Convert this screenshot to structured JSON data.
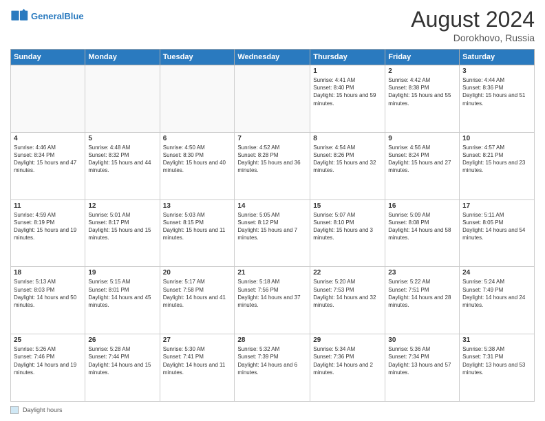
{
  "header": {
    "logo_line1": "General",
    "logo_line2": "Blue",
    "month_year": "August 2024",
    "location": "Dorokhovo, Russia"
  },
  "days_of_week": [
    "Sunday",
    "Monday",
    "Tuesday",
    "Wednesday",
    "Thursday",
    "Friday",
    "Saturday"
  ],
  "weeks": [
    [
      {
        "day": "",
        "sunrise": "",
        "sunset": "",
        "daylight": "",
        "empty": true
      },
      {
        "day": "",
        "sunrise": "",
        "sunset": "",
        "daylight": "",
        "empty": true
      },
      {
        "day": "",
        "sunrise": "",
        "sunset": "",
        "daylight": "",
        "empty": true
      },
      {
        "day": "",
        "sunrise": "",
        "sunset": "",
        "daylight": "",
        "empty": true
      },
      {
        "day": "1",
        "sunrise": "Sunrise: 4:41 AM",
        "sunset": "Sunset: 8:40 PM",
        "daylight": "Daylight: 15 hours and 59 minutes.",
        "empty": false
      },
      {
        "day": "2",
        "sunrise": "Sunrise: 4:42 AM",
        "sunset": "Sunset: 8:38 PM",
        "daylight": "Daylight: 15 hours and 55 minutes.",
        "empty": false
      },
      {
        "day": "3",
        "sunrise": "Sunrise: 4:44 AM",
        "sunset": "Sunset: 8:36 PM",
        "daylight": "Daylight: 15 hours and 51 minutes.",
        "empty": false
      }
    ],
    [
      {
        "day": "4",
        "sunrise": "Sunrise: 4:46 AM",
        "sunset": "Sunset: 8:34 PM",
        "daylight": "Daylight: 15 hours and 47 minutes.",
        "empty": false
      },
      {
        "day": "5",
        "sunrise": "Sunrise: 4:48 AM",
        "sunset": "Sunset: 8:32 PM",
        "daylight": "Daylight: 15 hours and 44 minutes.",
        "empty": false
      },
      {
        "day": "6",
        "sunrise": "Sunrise: 4:50 AM",
        "sunset": "Sunset: 8:30 PM",
        "daylight": "Daylight: 15 hours and 40 minutes.",
        "empty": false
      },
      {
        "day": "7",
        "sunrise": "Sunrise: 4:52 AM",
        "sunset": "Sunset: 8:28 PM",
        "daylight": "Daylight: 15 hours and 36 minutes.",
        "empty": false
      },
      {
        "day": "8",
        "sunrise": "Sunrise: 4:54 AM",
        "sunset": "Sunset: 8:26 PM",
        "daylight": "Daylight: 15 hours and 32 minutes.",
        "empty": false
      },
      {
        "day": "9",
        "sunrise": "Sunrise: 4:56 AM",
        "sunset": "Sunset: 8:24 PM",
        "daylight": "Daylight: 15 hours and 27 minutes.",
        "empty": false
      },
      {
        "day": "10",
        "sunrise": "Sunrise: 4:57 AM",
        "sunset": "Sunset: 8:21 PM",
        "daylight": "Daylight: 15 hours and 23 minutes.",
        "empty": false
      }
    ],
    [
      {
        "day": "11",
        "sunrise": "Sunrise: 4:59 AM",
        "sunset": "Sunset: 8:19 PM",
        "daylight": "Daylight: 15 hours and 19 minutes.",
        "empty": false
      },
      {
        "day": "12",
        "sunrise": "Sunrise: 5:01 AM",
        "sunset": "Sunset: 8:17 PM",
        "daylight": "Daylight: 15 hours and 15 minutes.",
        "empty": false
      },
      {
        "day": "13",
        "sunrise": "Sunrise: 5:03 AM",
        "sunset": "Sunset: 8:15 PM",
        "daylight": "Daylight: 15 hours and 11 minutes.",
        "empty": false
      },
      {
        "day": "14",
        "sunrise": "Sunrise: 5:05 AM",
        "sunset": "Sunset: 8:12 PM",
        "daylight": "Daylight: 15 hours and 7 minutes.",
        "empty": false
      },
      {
        "day": "15",
        "sunrise": "Sunrise: 5:07 AM",
        "sunset": "Sunset: 8:10 PM",
        "daylight": "Daylight: 15 hours and 3 minutes.",
        "empty": false
      },
      {
        "day": "16",
        "sunrise": "Sunrise: 5:09 AM",
        "sunset": "Sunset: 8:08 PM",
        "daylight": "Daylight: 14 hours and 58 minutes.",
        "empty": false
      },
      {
        "day": "17",
        "sunrise": "Sunrise: 5:11 AM",
        "sunset": "Sunset: 8:05 PM",
        "daylight": "Daylight: 14 hours and 54 minutes.",
        "empty": false
      }
    ],
    [
      {
        "day": "18",
        "sunrise": "Sunrise: 5:13 AM",
        "sunset": "Sunset: 8:03 PM",
        "daylight": "Daylight: 14 hours and 50 minutes.",
        "empty": false
      },
      {
        "day": "19",
        "sunrise": "Sunrise: 5:15 AM",
        "sunset": "Sunset: 8:01 PM",
        "daylight": "Daylight: 14 hours and 45 minutes.",
        "empty": false
      },
      {
        "day": "20",
        "sunrise": "Sunrise: 5:17 AM",
        "sunset": "Sunset: 7:58 PM",
        "daylight": "Daylight: 14 hours and 41 minutes.",
        "empty": false
      },
      {
        "day": "21",
        "sunrise": "Sunrise: 5:18 AM",
        "sunset": "Sunset: 7:56 PM",
        "daylight": "Daylight: 14 hours and 37 minutes.",
        "empty": false
      },
      {
        "day": "22",
        "sunrise": "Sunrise: 5:20 AM",
        "sunset": "Sunset: 7:53 PM",
        "daylight": "Daylight: 14 hours and 32 minutes.",
        "empty": false
      },
      {
        "day": "23",
        "sunrise": "Sunrise: 5:22 AM",
        "sunset": "Sunset: 7:51 PM",
        "daylight": "Daylight: 14 hours and 28 minutes.",
        "empty": false
      },
      {
        "day": "24",
        "sunrise": "Sunrise: 5:24 AM",
        "sunset": "Sunset: 7:49 PM",
        "daylight": "Daylight: 14 hours and 24 minutes.",
        "empty": false
      }
    ],
    [
      {
        "day": "25",
        "sunrise": "Sunrise: 5:26 AM",
        "sunset": "Sunset: 7:46 PM",
        "daylight": "Daylight: 14 hours and 19 minutes.",
        "empty": false
      },
      {
        "day": "26",
        "sunrise": "Sunrise: 5:28 AM",
        "sunset": "Sunset: 7:44 PM",
        "daylight": "Daylight: 14 hours and 15 minutes.",
        "empty": false
      },
      {
        "day": "27",
        "sunrise": "Sunrise: 5:30 AM",
        "sunset": "Sunset: 7:41 PM",
        "daylight": "Daylight: 14 hours and 11 minutes.",
        "empty": false
      },
      {
        "day": "28",
        "sunrise": "Sunrise: 5:32 AM",
        "sunset": "Sunset: 7:39 PM",
        "daylight": "Daylight: 14 hours and 6 minutes.",
        "empty": false
      },
      {
        "day": "29",
        "sunrise": "Sunrise: 5:34 AM",
        "sunset": "Sunset: 7:36 PM",
        "daylight": "Daylight: 14 hours and 2 minutes.",
        "empty": false
      },
      {
        "day": "30",
        "sunrise": "Sunrise: 5:36 AM",
        "sunset": "Sunset: 7:34 PM",
        "daylight": "Daylight: 13 hours and 57 minutes.",
        "empty": false
      },
      {
        "day": "31",
        "sunrise": "Sunrise: 5:38 AM",
        "sunset": "Sunset: 7:31 PM",
        "daylight": "Daylight: 13 hours and 53 minutes.",
        "empty": false
      }
    ]
  ],
  "footer": {
    "legend_label": "Daylight hours"
  }
}
